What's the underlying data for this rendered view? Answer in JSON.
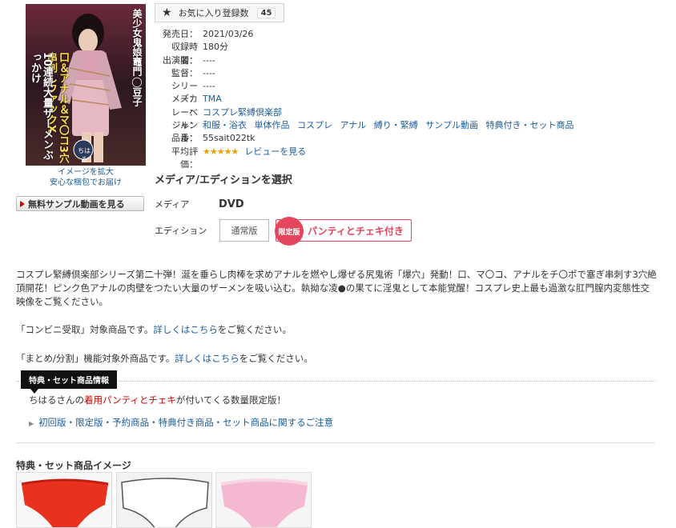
{
  "favorite": {
    "label": "お気に入り登録数",
    "count": "45"
  },
  "cover": {
    "title_lines": [
      "美少女鬼娘竈門◯豆子",
      "口＆アナル＆マ〇コ3穴串刺しファックX",
      "10連続大量ザーメンぶっかけ"
    ],
    "performer_badge": "ちはる",
    "caption_1": "イメージを拡大",
    "caption_2": "安心な梱包でお届け"
  },
  "sample_button": "無料サンプル動画を見る",
  "info": {
    "release_label": "発売日：",
    "release_value": "2021/03/26",
    "duration_label": "収録時間：",
    "duration_value": "180分",
    "cast_label": "出演者：",
    "cast_value": "----",
    "director_label": "監督：",
    "director_value": "----",
    "series_label": "シリーズ：",
    "series_value": "----",
    "maker_label": "メーカー：",
    "maker_value": "TMA",
    "label_label": "レーベル：",
    "label_value": "コスプレ緊縛倶楽部",
    "genre_label": "ジャンル：",
    "genres": [
      "和服・浴衣",
      "単体作品",
      "コスプレ",
      "アナル",
      "縛り・緊縛",
      "サンプル動画",
      "特典付き・セット商品"
    ],
    "code_label": "品番：",
    "code_value": "55sait022tk",
    "rating_label": "平均評価：",
    "rating_stars": "★★★★★",
    "review_link": "レビューを見る"
  },
  "media": {
    "section_title": "メディア/エディションを選択",
    "media_label": "メディア",
    "media_value": "DVD",
    "edition_label": "エディション",
    "edition_normal": "通常版",
    "edition_limited_badge": "限定版",
    "edition_limited": "パンティとチェキ付き"
  },
  "description": "コスプレ緊縛倶楽部シリーズ第二十弾！涎を垂らし肉棒を求めアナルを燃やし爆ぜる尻鬼術「爆穴」発動！口、マ〇コ、アナルをチ〇ポで塞ぎ串刺す3穴絶頂開花！ピンク色アナルの肉壁をつたい大量のザーメンを吸い込む。執拗な凌●の果てに淫鬼として本能覚醒！コスプレ史上最も過激な肛門膣内変態性交映像をご覧ください。",
  "conbini": {
    "pre": "「コンビニ受取」対象商品です。",
    "link": "詳しくはこちら",
    "post": "をご覧ください。"
  },
  "matome": {
    "pre": "「まとめ/分割」機能対象外商品です。",
    "link": "詳しくはこちら",
    "post": "をご覧ください。"
  },
  "tokuten": {
    "tag": "特典・セット商品情報",
    "text_pre": "ちはるさんの",
    "text_red1": "着用",
    "text_red2": "パンティとチェキ",
    "text_post": "が付いてくる数量限定版！",
    "notice": "初回版・限定版・予約商品・特典付き商品・セット商品に関するご注意"
  },
  "images_title": "特典・セット商品イメージ",
  "colors": {
    "link": "#1a5b9a",
    "limited": "#e6455e",
    "red": "#cc0000",
    "star": "#e8a400"
  }
}
